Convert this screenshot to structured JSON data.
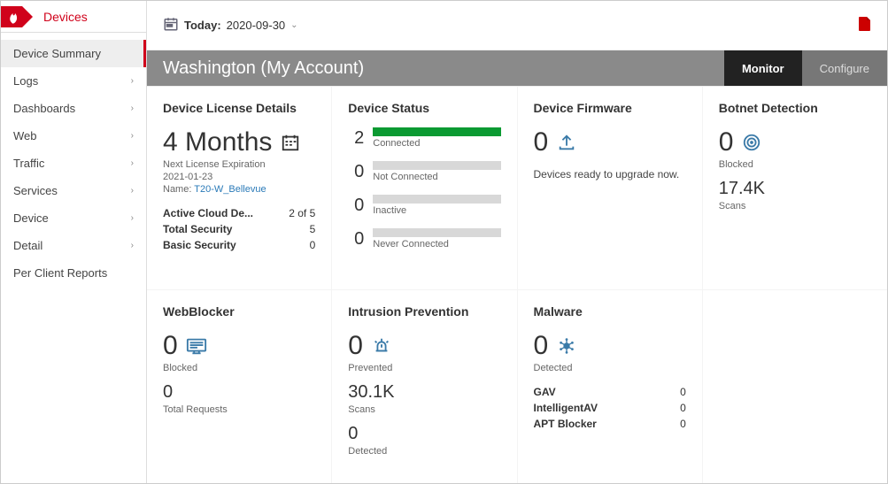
{
  "brand": {
    "label": "Devices"
  },
  "nav": {
    "items": [
      {
        "label": "Device Summary",
        "hasChildren": false,
        "active": true
      },
      {
        "label": "Logs",
        "hasChildren": true
      },
      {
        "label": "Dashboards",
        "hasChildren": true
      },
      {
        "label": "Web",
        "hasChildren": true
      },
      {
        "label": "Traffic",
        "hasChildren": true
      },
      {
        "label": "Services",
        "hasChildren": true
      },
      {
        "label": "Device",
        "hasChildren": true
      },
      {
        "label": "Detail",
        "hasChildren": true
      },
      {
        "label": "Per Client Reports",
        "hasChildren": false
      }
    ]
  },
  "topbar": {
    "date_label": "Today:",
    "date_value": "2020-09-30"
  },
  "titlebar": {
    "title": "Washington (My Account)",
    "tab_monitor": "Monitor",
    "tab_configure": "Configure"
  },
  "cards": {
    "license": {
      "title": "Device License Details",
      "duration": "4 Months",
      "exp_label": "Next License Expiration",
      "exp_date": "2021-01-23",
      "name_label": "Name:",
      "name_link": "T20-W_Bellevue",
      "rows": [
        {
          "k": "Active Cloud De...",
          "v": "2 of 5"
        },
        {
          "k": "Total Security",
          "v": "5"
        },
        {
          "k": "Basic Security",
          "v": "0"
        }
      ]
    },
    "status": {
      "title": "Device Status",
      "rows": [
        {
          "n": "2",
          "label": "Connected",
          "pct": 100
        },
        {
          "n": "0",
          "label": "Not Connected",
          "pct": 0
        },
        {
          "n": "0",
          "label": "Inactive",
          "pct": 0
        },
        {
          "n": "0",
          "label": "Never Connected",
          "pct": 0
        }
      ]
    },
    "firmware": {
      "title": "Device Firmware",
      "value": "0",
      "sub": "Devices ready to upgrade now."
    },
    "botnet": {
      "title": "Botnet Detection",
      "value": "0",
      "label1": "Blocked",
      "value2": "17.4K",
      "label2": "Scans"
    },
    "webblocker": {
      "title": "WebBlocker",
      "value": "0",
      "label1": "Blocked",
      "value2": "0",
      "label2": "Total Requests"
    },
    "ips": {
      "title": "Intrusion Prevention",
      "value": "0",
      "label1": "Prevented",
      "value2": "30.1K",
      "label2": "Scans",
      "value3": "0",
      "label3": "Detected"
    },
    "malware": {
      "title": "Malware",
      "value": "0",
      "label1": "Detected",
      "rows": [
        {
          "k": "GAV",
          "v": "0"
        },
        {
          "k": "IntelligentAV",
          "v": "0"
        },
        {
          "k": "APT Blocker",
          "v": "0"
        }
      ]
    }
  }
}
